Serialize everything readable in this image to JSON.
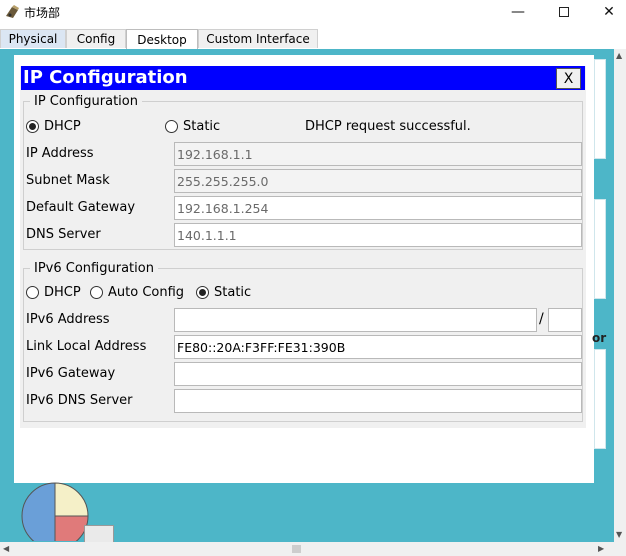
{
  "window": {
    "title": "市场部",
    "minimize_glyph": "—",
    "close_glyph": "✕",
    "app_icon": "router-icon"
  },
  "tabs": [
    {
      "label": "Physical"
    },
    {
      "label": "Config"
    },
    {
      "label": "Desktop",
      "active": true
    },
    {
      "label": "Custom Interface"
    }
  ],
  "desktop": {
    "edge_label": "or"
  },
  "dialog": {
    "title": "IP Configuration",
    "close_label": "X",
    "ipv4": {
      "legend": "IP Configuration",
      "mode_options": [
        {
          "label": "DHCP",
          "selected": true
        },
        {
          "label": "Static",
          "selected": false
        }
      ],
      "status": "DHCP request successful.",
      "fields": [
        {
          "label": "IP Address",
          "value": "192.168.1.1"
        },
        {
          "label": "Subnet Mask",
          "value": "255.255.255.0"
        },
        {
          "label": "Default Gateway",
          "value": "192.168.1.254"
        },
        {
          "label": "DNS Server",
          "value": "140.1.1.1"
        }
      ]
    },
    "ipv6": {
      "legend": "IPv6 Configuration",
      "mode_options": [
        {
          "label": "DHCP",
          "selected": false
        },
        {
          "label": "Auto Config",
          "selected": false
        },
        {
          "label": "Static",
          "selected": true
        }
      ],
      "prefix_separator": "/",
      "fields": [
        {
          "label": "IPv6 Address",
          "value": "",
          "prefix": ""
        },
        {
          "label": "Link Local Address",
          "value": "FE80::20A:F3FF:FE31:390B"
        },
        {
          "label": "IPv6 Gateway",
          "value": ""
        },
        {
          "label": "IPv6 DNS Server",
          "value": ""
        }
      ]
    }
  },
  "colors": {
    "dialog_header": "#0000ff",
    "desktop_background": "#4db6c8"
  }
}
